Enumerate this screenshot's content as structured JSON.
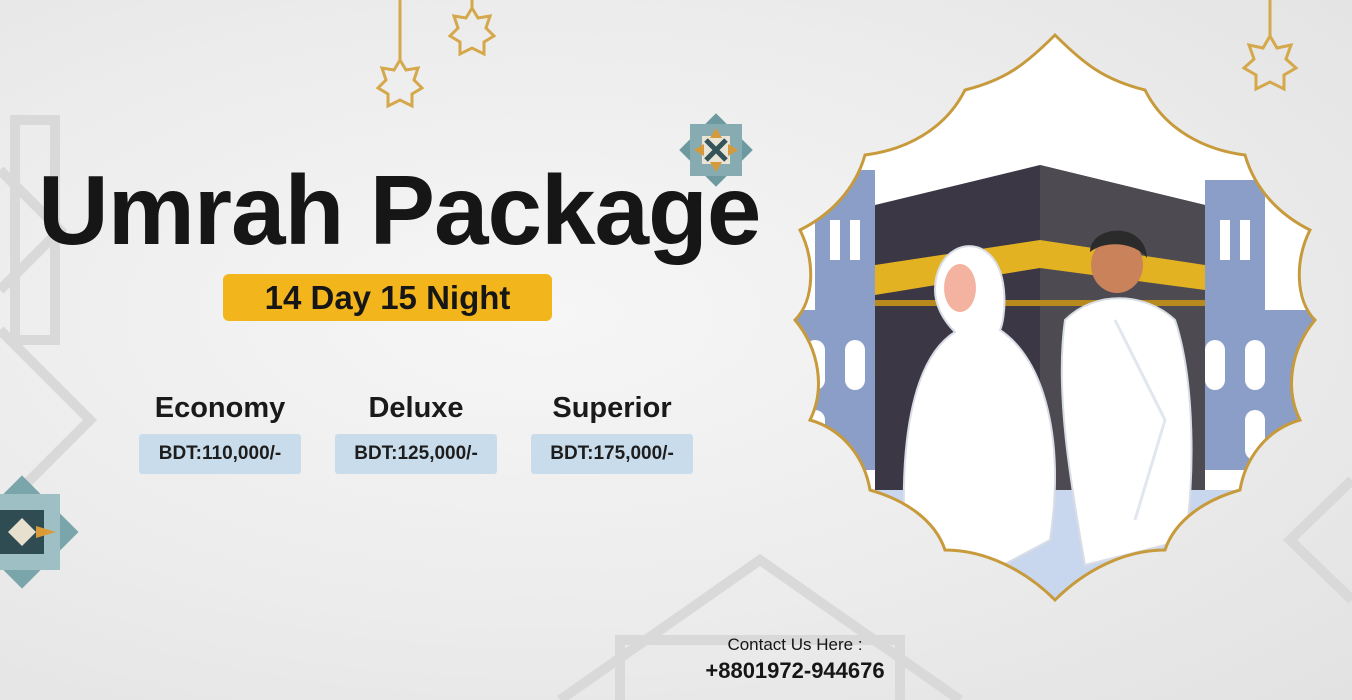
{
  "banner": {
    "title": "Umrah Package",
    "duration": "14 Day 15 Night"
  },
  "tiers": [
    {
      "name": "Economy",
      "price": "BDT:110,000/-"
    },
    {
      "name": "Deluxe",
      "price": "BDT:125,000/-"
    },
    {
      "name": "Superior",
      "price": "BDT:175,000/-"
    }
  ],
  "contact": {
    "label": "Contact Us Here :",
    "phone": "+8801972-944676"
  },
  "colors": {
    "accent_gold": "#f2b51c",
    "price_box": "#c9dceb",
    "frame_gold": "#c79a3c",
    "kaaba": "#3c3744"
  },
  "icons": [
    "hanging-star-ornament-icon",
    "islamic-star-ornament-icon",
    "kaaba-pilgrims-illustration"
  ]
}
